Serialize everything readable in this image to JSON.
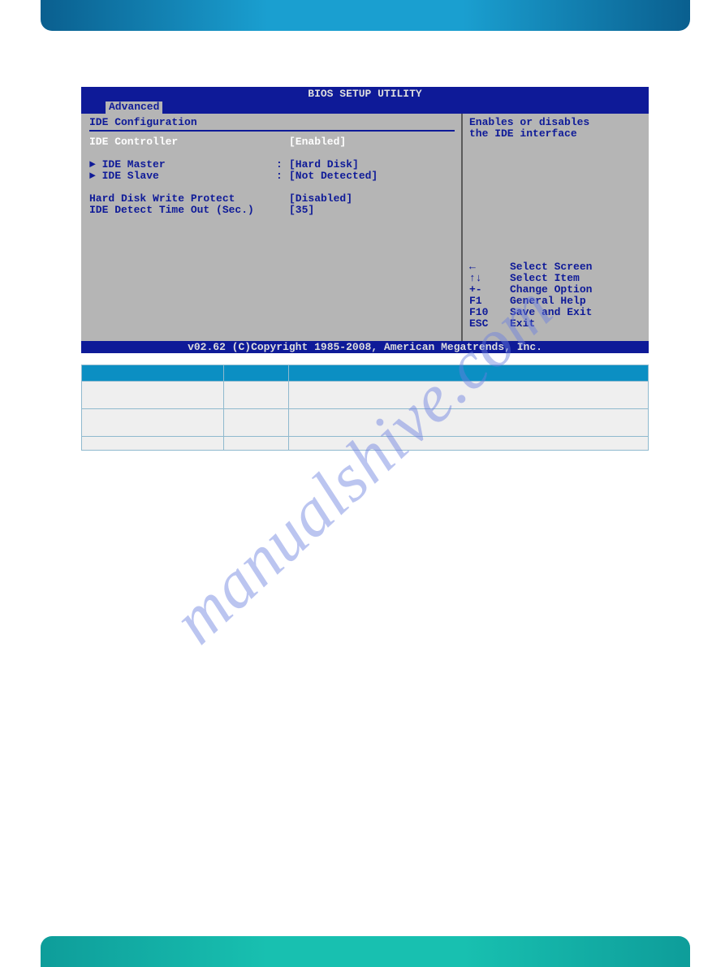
{
  "watermark": "manualshive.com",
  "bios": {
    "title": "BIOS SETUP UTILITY",
    "active_tab": "Advanced",
    "section_title": "IDE Configuration",
    "rows": [
      {
        "label": "IDE Controller",
        "sep": " ",
        "value": "[Enabled]",
        "highlight": true
      },
      {
        "spacer": true
      },
      {
        "label": "► IDE Master",
        "sep": ":",
        "value": "[Hard Disk]"
      },
      {
        "label": "► IDE Slave",
        "sep": ":",
        "value": "[Not Detected]"
      },
      {
        "spacer": true
      },
      {
        "label": "Hard Disk Write Protect",
        "sep": " ",
        "value": "[Disabled]"
      },
      {
        "label": "IDE Detect Time Out (Sec.)",
        "sep": " ",
        "value": "[35]"
      }
    ],
    "help_text_l1": "Enables or disables",
    "help_text_l2": "the IDE interface",
    "nav": [
      {
        "key": "←",
        "action": "Select Screen"
      },
      {
        "key": "↑↓",
        "action": "Select Item"
      },
      {
        "key": "+-",
        "action": "Change Option"
      },
      {
        "key": "F1",
        "action": "General Help"
      },
      {
        "key": "F10",
        "action": "Save and Exit"
      },
      {
        "key": "ESC",
        "action": "Exit"
      }
    ],
    "footer": "v02.62 (C)Copyright 1985-2008, American Megatrends, Inc."
  },
  "table": {
    "headers": [
      "",
      "",
      ""
    ],
    "rows": [
      [
        "",
        "",
        ""
      ],
      [
        "",
        "",
        ""
      ],
      [
        "",
        "",
        ""
      ]
    ]
  }
}
